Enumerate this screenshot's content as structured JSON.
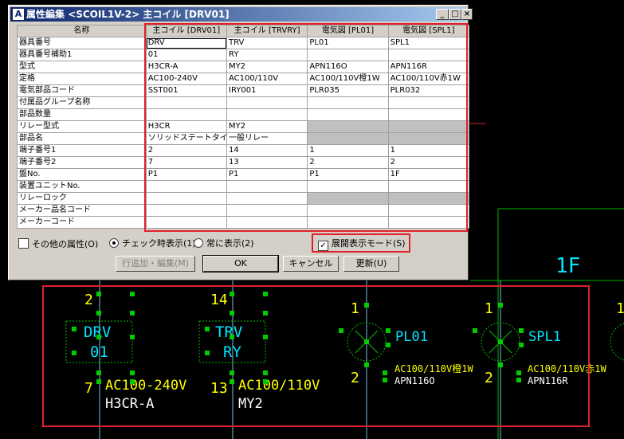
{
  "dialog": {
    "title": "属性編集 <SCOIL1V-2> 主コイル [DRV01]",
    "controls": {
      "minimize": "_",
      "maximize": "□",
      "close": "×"
    }
  },
  "grid": {
    "headers": [
      "名称",
      "主コイル [DRV01]",
      "主コイル [TRVRY]",
      "電気図 [PL01]",
      "電気図 [SPL1]"
    ],
    "rows": [
      {
        "name": "器具番号",
        "values": [
          "DRV",
          "TRV",
          "PL01",
          "SPL1"
        ]
      },
      {
        "name": "器具番号補助1",
        "values": [
          "01",
          "RY",
          "",
          ""
        ]
      },
      {
        "name": "型式",
        "values": [
          "H3CR-A",
          "MY2",
          "APN116O",
          "APN116R"
        ]
      },
      {
        "name": "定格",
        "values": [
          "AC100-240V",
          "AC100/110V",
          "AC100/110V橙1W",
          "AC100/110V赤1W"
        ]
      },
      {
        "name": "電気部品コード",
        "values": [
          "SST001",
          "IRY001",
          "PLR035",
          "PLR032"
        ]
      },
      {
        "name": "付属品グループ名称",
        "values": [
          "",
          "",
          "",
          ""
        ]
      },
      {
        "name": "部品数量",
        "values": [
          "",
          "",
          "",
          ""
        ]
      },
      {
        "name": "リレー型式",
        "values": [
          "H3CR",
          "MY2",
          "",
          ""
        ]
      },
      {
        "name": "部品名",
        "values": [
          "ソリッドステートタイマ",
          "一般リレー",
          "",
          ""
        ]
      },
      {
        "name": "端子番号1",
        "values": [
          "2",
          "14",
          "1",
          "1"
        ]
      },
      {
        "name": "端子番号2",
        "values": [
          "7",
          "13",
          "2",
          "2"
        ]
      },
      {
        "name": "盤No.",
        "values": [
          "P1",
          "P1",
          "P1",
          "1F"
        ]
      },
      {
        "name": "装置ユニットNo.",
        "values": [
          "",
          "",
          "",
          ""
        ]
      },
      {
        "name": "リレーロック",
        "values": [
          "",
          "",
          "",
          ""
        ]
      },
      {
        "name": "メーカー品名コード",
        "values": [
          "",
          "",
          "",
          ""
        ]
      },
      {
        "name": "メーカーコード",
        "values": [
          "",
          "",
          "",
          ""
        ]
      }
    ]
  },
  "options": {
    "other_attrs": "その他の属性(O)",
    "show_on_check": "チェック時表示(1)",
    "always_show": "常に表示(2)",
    "expand_mode": "展開表示モード(S)"
  },
  "buttons": {
    "add_edit": "行追加・編集(M)",
    "ok": "OK",
    "cancel": "キャンセル",
    "update": "更新(U)"
  },
  "drawing": {
    "panel_label": "1F",
    "components": [
      {
        "tag": "DRV",
        "sub": "01",
        "t1": "2",
        "t2": "7",
        "rating": "AC100-240V",
        "model": "H3CR-A"
      },
      {
        "tag": "TRV",
        "sub": "RY",
        "t1": "14",
        "t2": "13",
        "rating": "AC100/110V",
        "model": "MY2"
      },
      {
        "tag": "PL01",
        "t1": "1",
        "t2": "2",
        "rating": "AC100/110V橙1W",
        "model": "APN116O"
      },
      {
        "tag": "SPL1",
        "t1": "1",
        "t2": "2",
        "rating": "AC100/110V赤1W",
        "model": "APN116R"
      }
    ],
    "extra_terminal": "1"
  },
  "colors": {
    "highlight": "#e0202a",
    "tag": "#00e5ff",
    "rating": "#ffff00",
    "terminal": "#ffff00",
    "node": "#00cc00",
    "frame": "#00c000"
  }
}
